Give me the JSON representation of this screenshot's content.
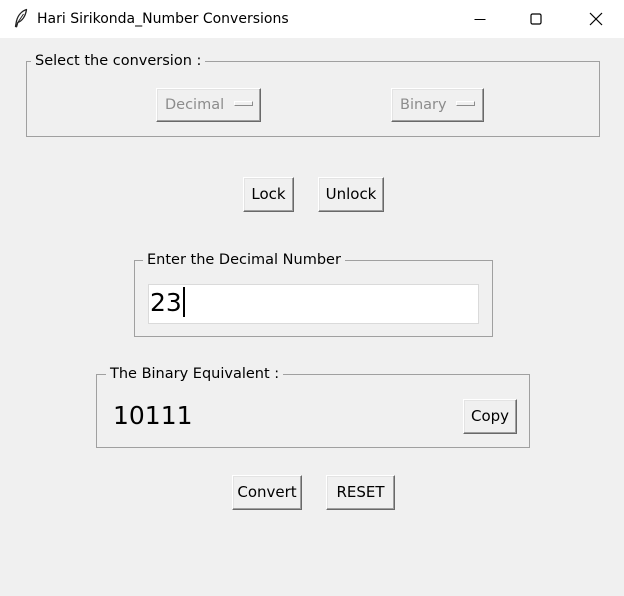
{
  "window": {
    "title": "Hari Sirikonda_Number Conversions",
    "icon": "feather-icon",
    "controls": [
      "minimize-icon",
      "maximize-icon",
      "close-icon"
    ]
  },
  "conversion_select": {
    "frame_label": "Select the conversion :",
    "from_value": "Decimal",
    "to_value": "Binary"
  },
  "lock_buttons": {
    "lock_label": "Lock",
    "unlock_label": "Unlock"
  },
  "input_section": {
    "frame_label": "Enter the Decimal Number",
    "value": "23"
  },
  "output_section": {
    "frame_label": "The Binary Equivalent :",
    "value": "10111",
    "copy_label": "Copy"
  },
  "actions": {
    "convert_label": "Convert",
    "reset_label": "RESET"
  },
  "colors": {
    "window_bg": "#f0f0f0",
    "titlebar_bg": "#ffffff",
    "disabled_text": "#8c8c8c",
    "frame_border": "#a0a0a0"
  }
}
